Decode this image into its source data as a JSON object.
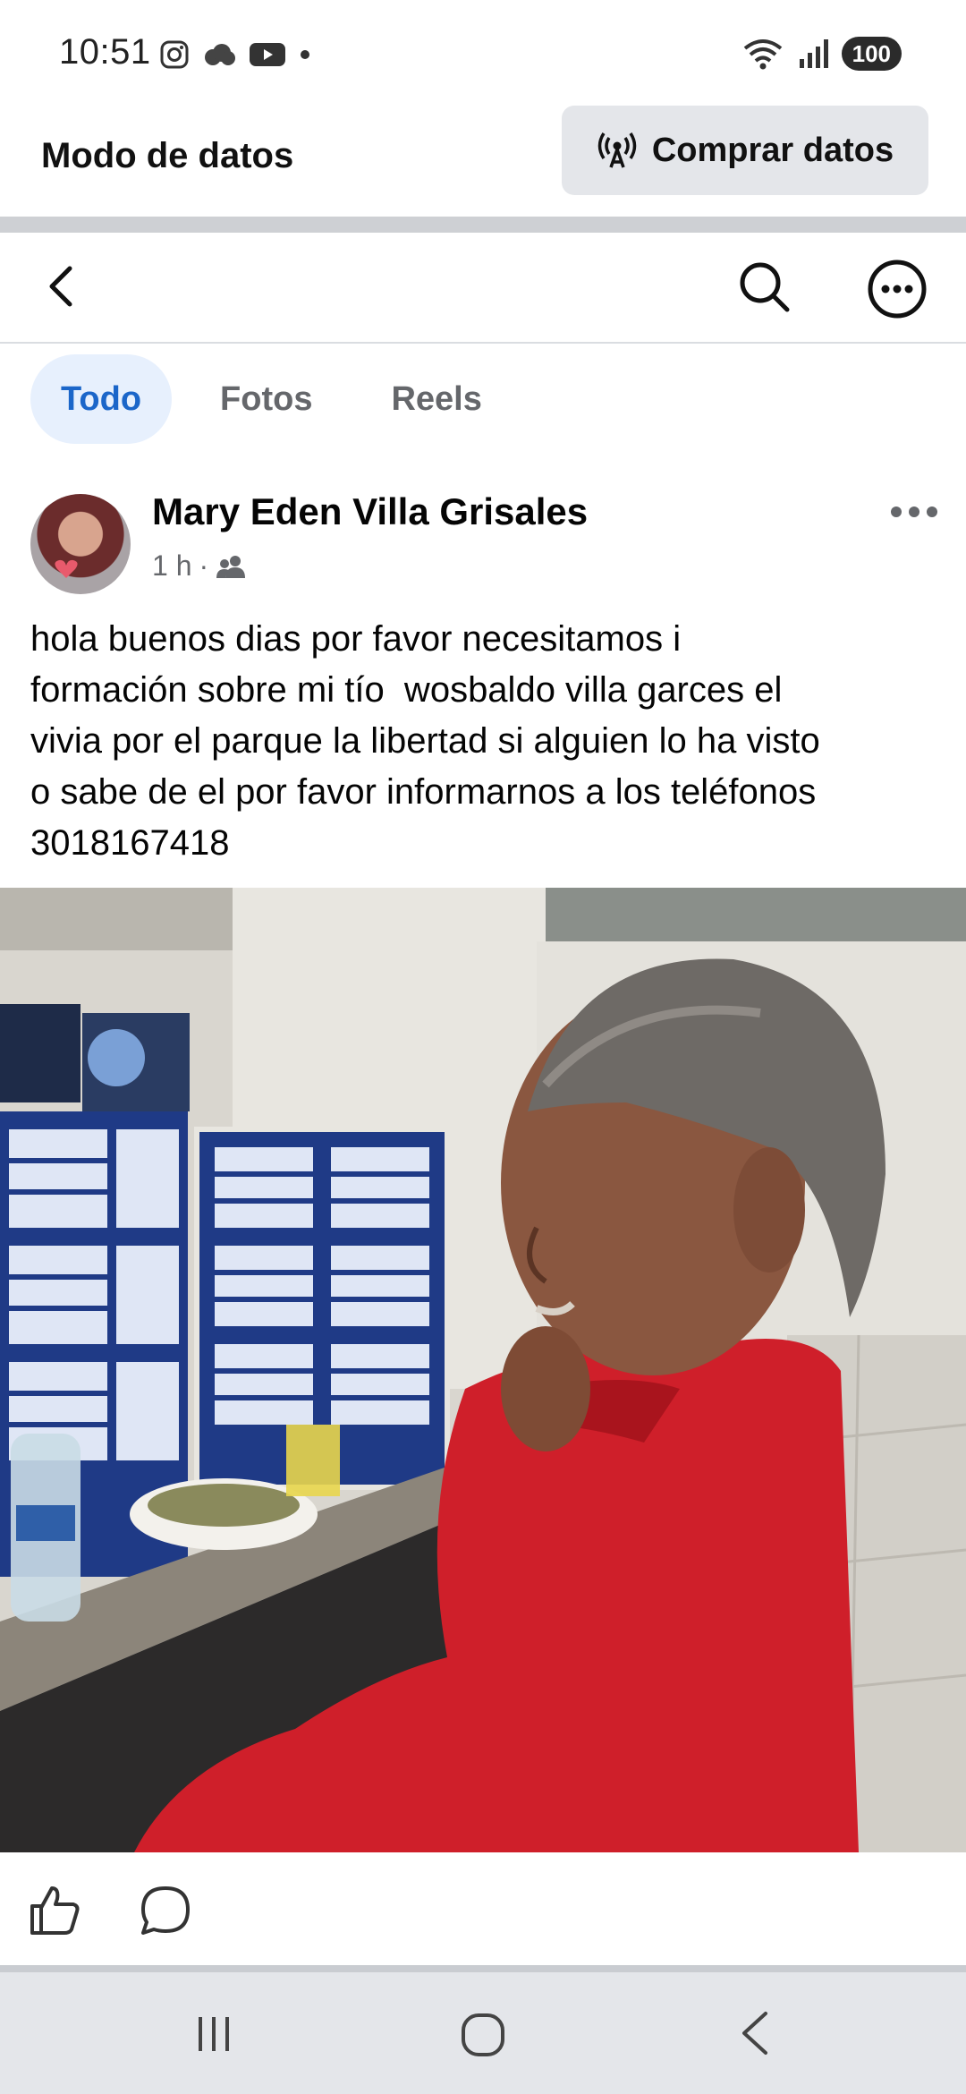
{
  "status_bar": {
    "time": "10:51",
    "battery": "100",
    "left_icons": [
      "instagram-icon",
      "cloud-icon",
      "youtube-icon",
      "dot-icon"
    ],
    "right_icons": [
      "wifi-icon",
      "signal-icon"
    ]
  },
  "banner": {
    "label": "Modo de datos",
    "button_label": "Comprar datos",
    "button_icon": "broadcast-icon"
  },
  "tabs": [
    {
      "label": "Todo",
      "active": true
    },
    {
      "label": "Fotos",
      "active": false
    },
    {
      "label": "Reels",
      "active": false
    }
  ],
  "post": {
    "author": "Mary Eden Villa Grisales",
    "time": "1 h",
    "separator": "·",
    "audience_icon": "friends-icon",
    "text": "hola buenos dias por favor necesitamos i\nformación sobre mi tío  wosbaldo villa garces el\nvivia por el parque la libertad si alguien lo ha visto\no sabe de el por favor informarnos a los teléfonos\n3018167418"
  },
  "colors": {
    "accent": "#1b66c9",
    "tab_active_bg": "#e7f0fd",
    "secondary_text": "#65676b",
    "button_bg": "#e4e6ea"
  }
}
